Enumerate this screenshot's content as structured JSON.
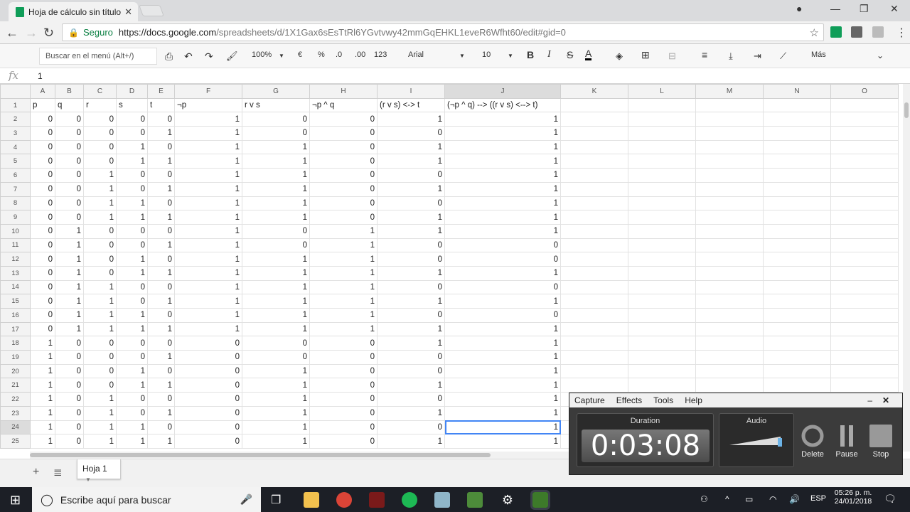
{
  "browser": {
    "tab_title": "Hoja de cálculo sin título",
    "secure_label": "Seguro",
    "url_host": "https://docs.google.com",
    "url_path": "/spreadsheets/d/1X1Gax6sEsTtRl6YGvtvwy42mmGqEHKL1eveR6Wfht60/edit#gid=0"
  },
  "toolbar": {
    "menu_search_placeholder": "Buscar en el menú (Alt+/)",
    "zoom": "100%",
    "currency": "€",
    "percent": "%",
    "dec_less": ".0",
    "dec_more": ".00",
    "format_more": "123",
    "font": "Arial",
    "font_size": "10",
    "more": "Más"
  },
  "formula_bar": {
    "fx": "fx",
    "value": "1"
  },
  "sheet": {
    "columns": [
      "A",
      "B",
      "C",
      "D",
      "E",
      "F",
      "G",
      "H",
      "I",
      "J",
      "K",
      "L",
      "M",
      "N",
      "O"
    ],
    "header_row": [
      "p",
      "q",
      "r",
      "s",
      "t",
      "¬p",
      "r v s",
      "¬p ^ q",
      "(r v s) <-> t",
      "(¬p ^ q) --> ((r v s) <--> t)"
    ],
    "rows": [
      [
        "0",
        "0",
        "0",
        "0",
        "0",
        "1",
        "0",
        "0",
        "1",
        "1"
      ],
      [
        "0",
        "0",
        "0",
        "0",
        "1",
        "1",
        "0",
        "0",
        "0",
        "1"
      ],
      [
        "0",
        "0",
        "0",
        "1",
        "0",
        "1",
        "1",
        "0",
        "1",
        "1"
      ],
      [
        "0",
        "0",
        "0",
        "1",
        "1",
        "1",
        "1",
        "0",
        "1",
        "1"
      ],
      [
        "0",
        "0",
        "1",
        "0",
        "0",
        "1",
        "1",
        "0",
        "0",
        "1"
      ],
      [
        "0",
        "0",
        "1",
        "0",
        "1",
        "1",
        "1",
        "0",
        "1",
        "1"
      ],
      [
        "0",
        "0",
        "1",
        "1",
        "0",
        "1",
        "1",
        "0",
        "0",
        "1"
      ],
      [
        "0",
        "0",
        "1",
        "1",
        "1",
        "1",
        "1",
        "0",
        "1",
        "1"
      ],
      [
        "0",
        "1",
        "0",
        "0",
        "0",
        "1",
        "0",
        "1",
        "1",
        "1"
      ],
      [
        "0",
        "1",
        "0",
        "0",
        "1",
        "1",
        "0",
        "1",
        "0",
        "0"
      ],
      [
        "0",
        "1",
        "0",
        "1",
        "0",
        "1",
        "1",
        "1",
        "0",
        "0"
      ],
      [
        "0",
        "1",
        "0",
        "1",
        "1",
        "1",
        "1",
        "1",
        "1",
        "1"
      ],
      [
        "0",
        "1",
        "1",
        "0",
        "0",
        "1",
        "1",
        "1",
        "0",
        "0"
      ],
      [
        "0",
        "1",
        "1",
        "0",
        "1",
        "1",
        "1",
        "1",
        "1",
        "1"
      ],
      [
        "0",
        "1",
        "1",
        "1",
        "0",
        "1",
        "1",
        "1",
        "0",
        "0"
      ],
      [
        "0",
        "1",
        "1",
        "1",
        "1",
        "1",
        "1",
        "1",
        "1",
        "1"
      ],
      [
        "1",
        "0",
        "0",
        "0",
        "0",
        "0",
        "0",
        "0",
        "1",
        "1"
      ],
      [
        "1",
        "0",
        "0",
        "0",
        "1",
        "0",
        "0",
        "0",
        "0",
        "1"
      ],
      [
        "1",
        "0",
        "0",
        "1",
        "0",
        "0",
        "1",
        "0",
        "0",
        "1"
      ],
      [
        "1",
        "0",
        "0",
        "1",
        "1",
        "0",
        "1",
        "0",
        "1",
        "1"
      ],
      [
        "1",
        "0",
        "1",
        "0",
        "0",
        "0",
        "1",
        "0",
        "0",
        "1"
      ],
      [
        "1",
        "0",
        "1",
        "0",
        "1",
        "0",
        "1",
        "0",
        "1",
        "1"
      ],
      [
        "1",
        "0",
        "1",
        "1",
        "0",
        "0",
        "1",
        "0",
        "0",
        "1"
      ],
      [
        "1",
        "0",
        "1",
        "1",
        "1",
        "0",
        "1",
        "0",
        "1",
        "1"
      ]
    ],
    "sheet_tab": "Hoja 1"
  },
  "recorder": {
    "menu": [
      "Capture",
      "Effects",
      "Tools",
      "Help"
    ],
    "duration_label": "Duration",
    "audio_label": "Audio",
    "time": "0:03:08",
    "buttons": [
      "Delete",
      "Pause",
      "Stop"
    ]
  },
  "taskbar": {
    "search_placeholder": "Escribe aquí para buscar",
    "lang": "ESP",
    "time": "05:26 p. m.",
    "date": "24/01/2018"
  }
}
